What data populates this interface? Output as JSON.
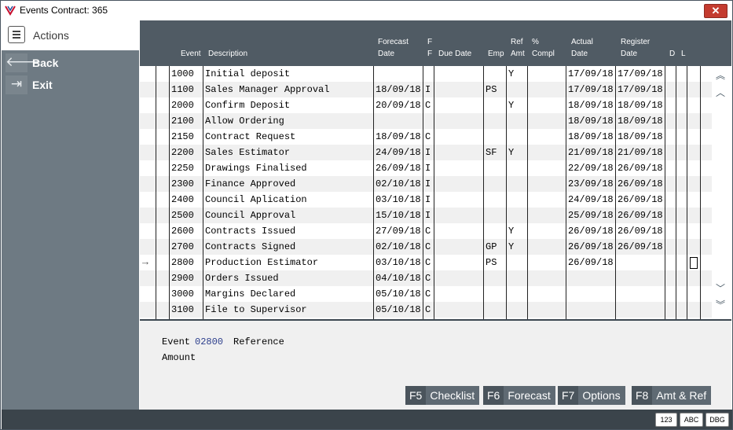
{
  "window": {
    "title": "Events  Contract: 365",
    "close_glyph": "✕"
  },
  "sidebar": {
    "header": "Actions",
    "items": [
      {
        "label": "Back",
        "icon": "arrow-left-icon",
        "glyph": "🡐"
      },
      {
        "label": "Exit",
        "icon": "exit-icon",
        "glyph": "⇥"
      }
    ]
  },
  "grid": {
    "columns": {
      "event": "Event",
      "description": "Description",
      "forecast": [
        "Forecast",
        "Date"
      ],
      "ff": [
        "F",
        "F"
      ],
      "due": "Due Date",
      "emp": "Emp",
      "refamt": [
        "Ref",
        "Amt"
      ],
      "compl": [
        "%",
        "Compl"
      ],
      "actual": [
        "Actual",
        "Date"
      ],
      "register": [
        "Register",
        "Date"
      ],
      "d": "D",
      "l": "L"
    },
    "current_row_marker": "→",
    "rows": [
      {
        "event": "1000",
        "description": "Initial deposit",
        "forecast": "",
        "ff": "",
        "due": "",
        "emp": "",
        "ref": "Y",
        "compl": "",
        "actual": "17/09/18",
        "register": "17/09/18"
      },
      {
        "event": "1100",
        "description": "Sales Manager Approval",
        "forecast": "18/09/18",
        "ff": "I",
        "due": "",
        "emp": "PS",
        "ref": "",
        "compl": "",
        "actual": "17/09/18",
        "register": "17/09/18"
      },
      {
        "event": "2000",
        "description": "Confirm Deposit",
        "forecast": "20/09/18",
        "ff": "C",
        "due": "",
        "emp": "",
        "ref": "Y",
        "compl": "",
        "actual": "18/09/18",
        "register": "18/09/18"
      },
      {
        "event": "2100",
        "description": "Allow Ordering",
        "forecast": "",
        "ff": "",
        "due": "",
        "emp": "",
        "ref": "",
        "compl": "",
        "actual": "18/09/18",
        "register": "18/09/18"
      },
      {
        "event": "2150",
        "description": "Contract Request",
        "forecast": "18/09/18",
        "ff": "C",
        "due": "",
        "emp": "",
        "ref": "",
        "compl": "",
        "actual": "18/09/18",
        "register": "18/09/18"
      },
      {
        "event": "2200",
        "description": "Sales Estimator",
        "forecast": "24/09/18",
        "ff": "I",
        "due": "",
        "emp": "SF",
        "ref": "Y",
        "compl": "",
        "actual": "21/09/18",
        "register": "21/09/18"
      },
      {
        "event": "2250",
        "description": "Drawings Finalised",
        "forecast": "26/09/18",
        "ff": "I",
        "due": "",
        "emp": "",
        "ref": "",
        "compl": "",
        "actual": "22/09/18",
        "register": "26/09/18"
      },
      {
        "event": "2300",
        "description": "Finance Approved",
        "forecast": "02/10/18",
        "ff": "I",
        "due": "",
        "emp": "",
        "ref": "",
        "compl": "",
        "actual": "23/09/18",
        "register": "26/09/18"
      },
      {
        "event": "2400",
        "description": "Council Aplication",
        "forecast": "03/10/18",
        "ff": "I",
        "due": "",
        "emp": "",
        "ref": "",
        "compl": "",
        "actual": "24/09/18",
        "register": "26/09/18"
      },
      {
        "event": "2500",
        "description": "Council Approval",
        "forecast": "15/10/18",
        "ff": "I",
        "due": "",
        "emp": "",
        "ref": "",
        "compl": "",
        "actual": "25/09/18",
        "register": "26/09/18"
      },
      {
        "event": "2600",
        "description": "Contracts Issued",
        "forecast": "27/09/18",
        "ff": "C",
        "due": "",
        "emp": "",
        "ref": "Y",
        "compl": "",
        "actual": "26/09/18",
        "register": "26/09/18"
      },
      {
        "event": "2700",
        "description": "Contracts Signed",
        "forecast": "02/10/18",
        "ff": "C",
        "due": "",
        "emp": "GP",
        "ref": "Y",
        "compl": "",
        "actual": "26/09/18",
        "register": "26/09/18"
      },
      {
        "event": "2800",
        "description": "Production Estimator",
        "forecast": "03/10/18",
        "ff": "C",
        "due": "",
        "emp": "PS",
        "ref": "",
        "compl": "",
        "actual": "26/09/18",
        "register": ""
      },
      {
        "event": "2900",
        "description": "Orders Issued",
        "forecast": "04/10/18",
        "ff": "C",
        "due": "",
        "emp": "",
        "ref": "",
        "compl": "",
        "actual": "",
        "register": ""
      },
      {
        "event": "3000",
        "description": "Margins Declared",
        "forecast": "05/10/18",
        "ff": "C",
        "due": "",
        "emp": "",
        "ref": "",
        "compl": "",
        "actual": "",
        "register": ""
      },
      {
        "event": "3100",
        "description": "File to Supervisor",
        "forecast": "05/10/18",
        "ff": "C",
        "due": "",
        "emp": "",
        "ref": "",
        "compl": "",
        "actual": "",
        "register": ""
      }
    ]
  },
  "scroll": {
    "top": "︽",
    "up": "︿",
    "down": "﹀",
    "bottom": "︾"
  },
  "detail": {
    "event_label": "Event",
    "event_value": "02800",
    "reference_label": "Reference",
    "amount_label": "Amount"
  },
  "fkeys": [
    {
      "key": "F5",
      "label": "Checklist"
    },
    {
      "key": "F6",
      "label": "Forecast"
    },
    {
      "key": "F7",
      "label": "Options"
    },
    {
      "key": "F8",
      "label": "Amt & Ref"
    }
  ],
  "status": {
    "btn_123": "123",
    "btn_abc": "ABC",
    "btn_dbg": "DBG"
  }
}
